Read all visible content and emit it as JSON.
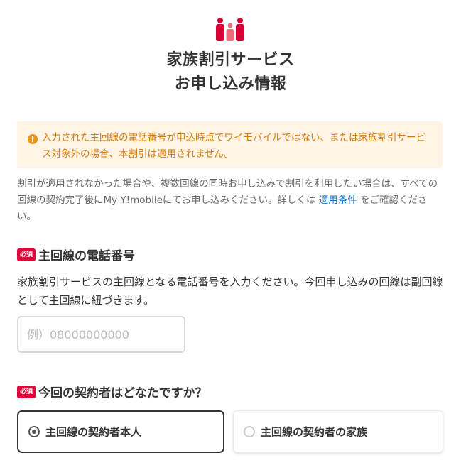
{
  "header": {
    "icon": "family-icon",
    "title_line1": "家族割引サービス",
    "title_line2": "お申し込み情報"
  },
  "notice": {
    "icon": "info-icon",
    "text": "入力された主回線の電話番号が申込時点でワイモバイルではない、または家族割引サービス対象外の場合、本割引は適用されません。",
    "color": "#d27a0a",
    "background": "#fff4e6"
  },
  "description": {
    "text_before": "割引が適用されなかった場合や、複数回線の同時お申し込みで割引を利用したい場合は、すべての回線の契約完了後にMy Y!mobileにてお申し込みください。詳しくは ",
    "link_text": "適用条件",
    "text_after": " をご確認ください。"
  },
  "main_line_section": {
    "required_badge": "必須",
    "title": "主回線の電話番号",
    "description": "家族割引サービスの主回線となる電話番号を入力ください。今回申し込みの回線は副回線として主回線に紐づきます。",
    "input_value": "",
    "input_placeholder": "例）08000000000"
  },
  "contractor_section": {
    "required_badge": "必須",
    "title": "今回の契約者はどなたですか？",
    "options": [
      {
        "label": "主回線の契約者本人",
        "selected": true
      },
      {
        "label": "主回線の契約者の家族",
        "selected": false
      }
    ]
  },
  "colors": {
    "brand_red": "#e60039",
    "link_blue": "#1a73c9"
  }
}
